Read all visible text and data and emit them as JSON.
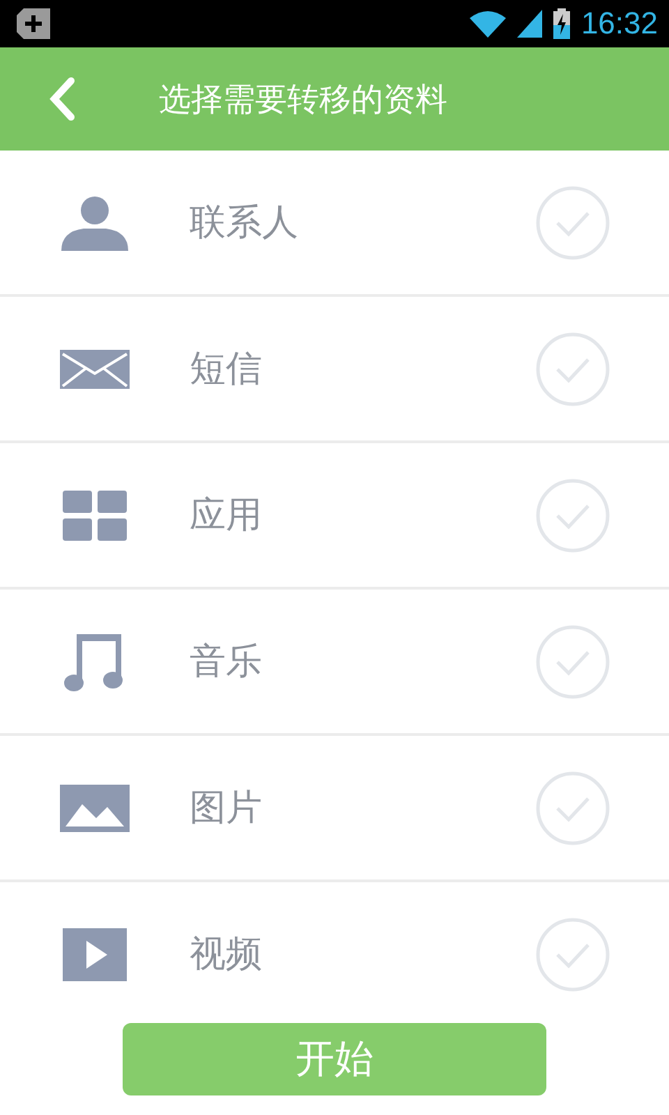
{
  "status_bar": {
    "time": "16:32"
  },
  "header": {
    "title": "选择需要转移的资料"
  },
  "items": [
    {
      "kind": "contacts",
      "label": "联系人",
      "selected": false
    },
    {
      "kind": "messages",
      "label": "短信",
      "selected": false
    },
    {
      "kind": "apps",
      "label": "应用",
      "selected": false
    },
    {
      "kind": "music",
      "label": "音乐",
      "selected": false
    },
    {
      "kind": "pictures",
      "label": "图片",
      "selected": false
    },
    {
      "kind": "videos",
      "label": "视频",
      "selected": false
    }
  ],
  "start_button": {
    "label": "开始"
  }
}
